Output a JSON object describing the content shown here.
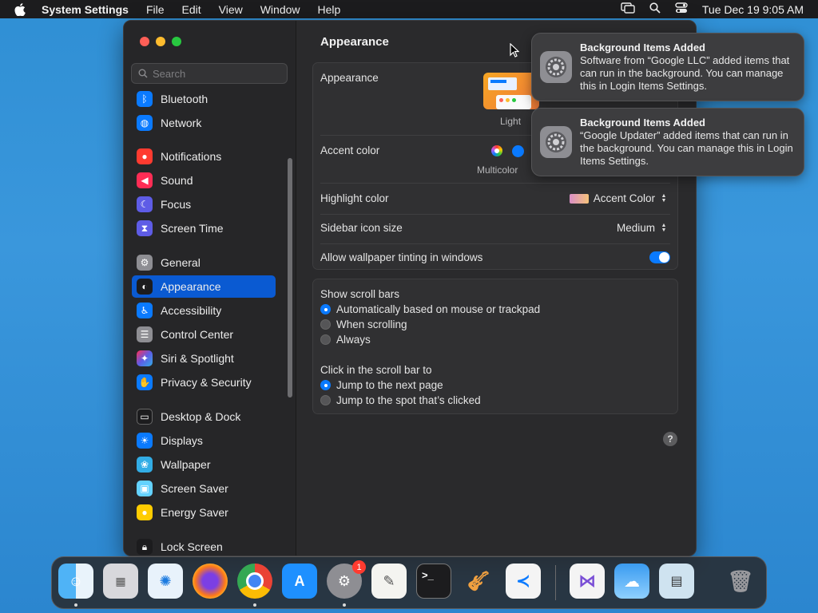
{
  "menubar": {
    "app_name": "System Settings",
    "menus": [
      "File",
      "Edit",
      "View",
      "Window",
      "Help"
    ],
    "clock": "Tue Dec 19  9:05 AM"
  },
  "sidebar": {
    "search_placeholder": "Search",
    "items": [
      {
        "label": "Bluetooth",
        "color": "#0a7aff"
      },
      {
        "label": "Network",
        "color": "#0a7aff"
      },
      {
        "label": "Notifications",
        "color": "#ff3b30"
      },
      {
        "label": "Sound",
        "color": "#ff2d55"
      },
      {
        "label": "Focus",
        "color": "#5e5ce6"
      },
      {
        "label": "Screen Time",
        "color": "#5e5ce6"
      },
      {
        "label": "General",
        "color": "#8e8e93"
      },
      {
        "label": "Appearance",
        "color": "#1c1c1e"
      },
      {
        "label": "Accessibility",
        "color": "#0a7aff"
      },
      {
        "label": "Control Center",
        "color": "#8e8e93"
      },
      {
        "label": "Siri & Spotlight",
        "color": "#bf5af2"
      },
      {
        "label": "Privacy & Security",
        "color": "#0a7aff"
      },
      {
        "label": "Desktop & Dock",
        "color": "#1c1c1e"
      },
      {
        "label": "Displays",
        "color": "#0a7aff"
      },
      {
        "label": "Wallpaper",
        "color": "#32ade6"
      },
      {
        "label": "Screen Saver",
        "color": "#64d2ff"
      },
      {
        "label": "Energy Saver",
        "color": "#ffcc00"
      },
      {
        "label": "Lock Screen",
        "color": "#1c1c1e"
      }
    ]
  },
  "content": {
    "title": "Appearance",
    "appearance_label": "Appearance",
    "appearance_option_light": "Light",
    "accent_label": "Accent color",
    "accent_caption": "Multicolor",
    "highlight_label": "Highlight color",
    "highlight_value": "Accent Color",
    "sidebar_icon_label": "Sidebar icon size",
    "sidebar_icon_value": "Medium",
    "tinting_label": "Allow wallpaper tinting in windows",
    "tinting_on": true,
    "scroll_title": "Show scroll bars",
    "scroll_options": [
      "Automatically based on mouse or trackpad",
      "When scrolling",
      "Always"
    ],
    "scroll_selected": 0,
    "click_title": "Click in the scroll bar to",
    "click_options": [
      "Jump to the next page",
      "Jump to the spot that’s clicked"
    ],
    "click_selected": 0,
    "help": "?"
  },
  "notifications": [
    {
      "title": "Background Items Added",
      "body": "Software from “Google LLC” added items that can run in the background. You can manage this in Login Items Settings."
    },
    {
      "title": "Background Items Added",
      "body": "“Google Updater” added items that can run in the background. You can manage this in Login Items Settings."
    }
  ],
  "dock": {
    "settings_badge": "1"
  },
  "colors": {
    "accent": "#0a7aff",
    "selection": "#0a5ad2"
  }
}
